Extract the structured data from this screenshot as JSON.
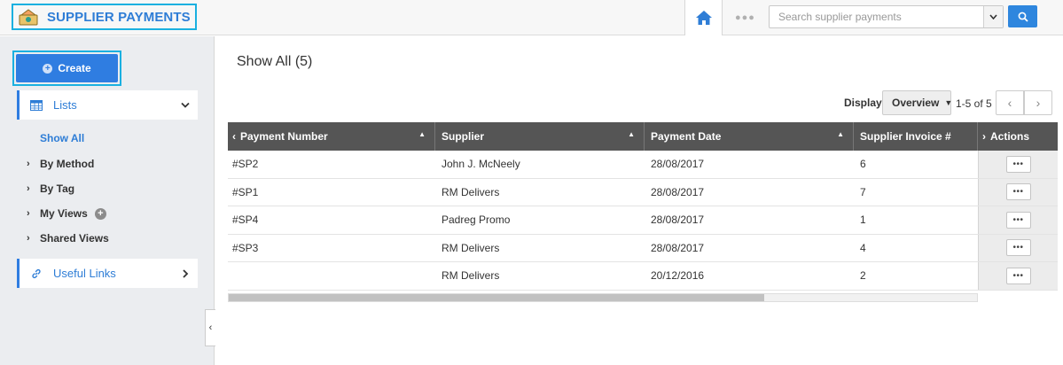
{
  "app": {
    "title": "SUPPLIER PAYMENTS"
  },
  "search": {
    "placeholder": "Search supplier payments"
  },
  "sidebar": {
    "create_label": "Create",
    "lists_label": "Lists",
    "items": [
      {
        "label": "Show All",
        "active": true
      },
      {
        "label": "By Method"
      },
      {
        "label": "By Tag"
      },
      {
        "label": "My Views"
      },
      {
        "label": "Shared Views"
      }
    ],
    "useful_links_label": "Useful Links"
  },
  "main": {
    "title": "Show All (5)",
    "display_label": "Display",
    "display_value": "Overview",
    "range": "1-5 of 5",
    "columns": [
      "Payment Number",
      "Supplier",
      "Payment Date",
      "Supplier Invoice #",
      "Actions"
    ],
    "rows": [
      {
        "number": "#SP2",
        "supplier": "John J. McNeely",
        "date": "28/08/2017",
        "invoice": "6"
      },
      {
        "number": "#SP1",
        "supplier": "RM Delivers",
        "date": "28/08/2017",
        "invoice": "7"
      },
      {
        "number": "#SP4",
        "supplier": "Padreg Promo",
        "date": "28/08/2017",
        "invoice": "1"
      },
      {
        "number": "#SP3",
        "supplier": "RM Delivers",
        "date": "28/08/2017",
        "invoice": "4"
      },
      {
        "number": "",
        "supplier": "RM Delivers",
        "date": "20/12/2016",
        "invoice": "2"
      }
    ],
    "actions_label": "•••"
  },
  "colors": {
    "accent": "#2f7de1",
    "highlight": "#1ab0e0",
    "header": "#555555"
  }
}
